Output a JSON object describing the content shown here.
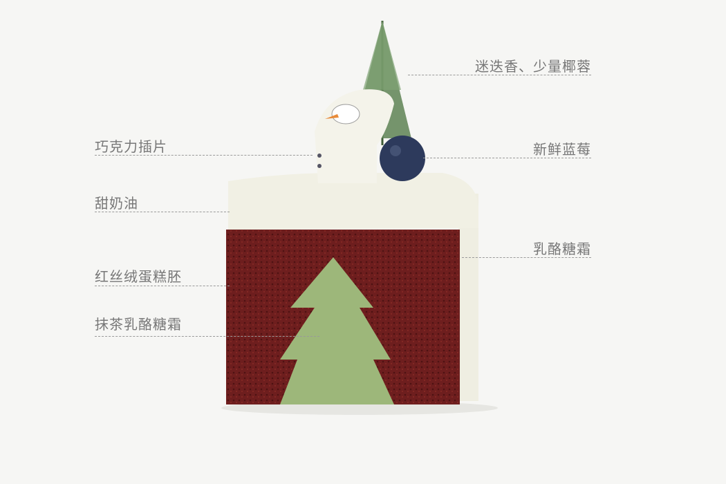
{
  "labels_left": [
    {
      "text": "巧克力插片"
    },
    {
      "text": "甜奶油"
    },
    {
      "text": "红丝绒蛋糕胚"
    },
    {
      "text": "抹茶乳酪糖霜"
    }
  ],
  "labels_right": [
    {
      "text": "迷迭香、少量椰蓉"
    },
    {
      "text": "新鲜蓝莓"
    },
    {
      "text": "乳酪糖霜"
    }
  ],
  "colors": {
    "cake": "#6e1e1e",
    "matcha": "#9db77a",
    "cream": "#efeee2",
    "blueberry": "#2d3a5c"
  }
}
